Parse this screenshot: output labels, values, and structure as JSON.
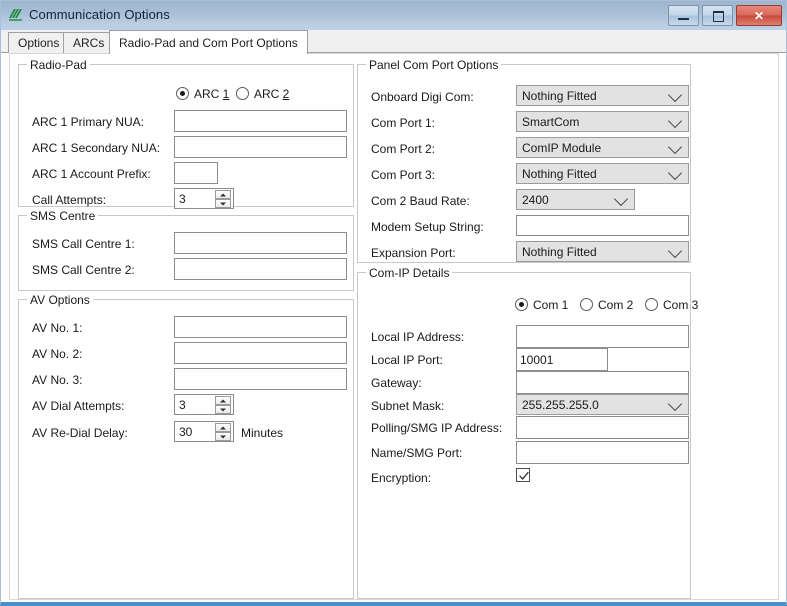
{
  "window": {
    "title": "Communication Options",
    "icon": "app-logo-icon",
    "buttons": {
      "minimize": "–",
      "maximize": "□",
      "close": "✕"
    }
  },
  "tabs": [
    {
      "label": "Options",
      "active": false
    },
    {
      "label": "ARCs",
      "active": false
    },
    {
      "label": "Radio-Pad and Com Port Options",
      "active": true
    }
  ],
  "radio_pad": {
    "legend": "Radio-Pad",
    "arc_radios": [
      {
        "label_prefix": "ARC ",
        "label_key": "1",
        "selected": true
      },
      {
        "label_prefix": "ARC ",
        "label_key": "2",
        "selected": false
      }
    ],
    "fields": [
      {
        "label": "ARC 1 Primary NUA:",
        "value": ""
      },
      {
        "label": "ARC 1 Secondary NUA:",
        "value": ""
      },
      {
        "label": "ARC 1 Account Prefix:",
        "value": ""
      }
    ],
    "call_attempts": {
      "label": "Call Attempts:",
      "value": "3"
    }
  },
  "sms_centre": {
    "legend": "SMS Centre",
    "fields": [
      {
        "label": "SMS Call Centre 1:",
        "value": ""
      },
      {
        "label": "SMS Call Centre 2:",
        "value": ""
      }
    ]
  },
  "av_options": {
    "legend": "AV Options",
    "fields": [
      {
        "label": "AV No. 1:",
        "value": ""
      },
      {
        "label": "AV No. 2:",
        "value": ""
      },
      {
        "label": "AV No. 3:",
        "value": ""
      }
    ],
    "dial_attempts": {
      "label": "AV Dial Attempts:",
      "value": "3"
    },
    "redial_delay": {
      "label": "AV Re-Dial Delay:",
      "value": "30",
      "units": "Minutes"
    }
  },
  "panel_com_port": {
    "legend": "Panel Com Port Options",
    "combos": [
      {
        "label": "Onboard Digi Com:",
        "value": "Nothing Fitted"
      },
      {
        "label": "Com Port 1:",
        "value": "SmartCom"
      },
      {
        "label": "Com Port 2:",
        "value": "ComIP Module"
      },
      {
        "label": "Com Port 3:",
        "value": "Nothing Fitted"
      }
    ],
    "baud_rate": {
      "label": "Com 2 Baud Rate:",
      "value": "2400"
    },
    "modem_setup": {
      "label": "Modem Setup String:",
      "value": ""
    },
    "expansion_port": {
      "label": "Expansion Port:",
      "value": "Nothing Fitted"
    }
  },
  "com_ip_details": {
    "legend": "Com-IP Details",
    "com_radios": [
      {
        "label": "Com 1",
        "selected": true
      },
      {
        "label": "Com 2",
        "selected": false
      },
      {
        "label": "Com 3",
        "selected": false
      }
    ],
    "local_ip_address": {
      "label": "Local IP Address:",
      "value": ""
    },
    "local_ip_port": {
      "label": "Local IP Port:",
      "value": "10001"
    },
    "gateway": {
      "label": "Gateway:",
      "value": ""
    },
    "subnet_mask": {
      "label": "Subnet Mask:",
      "value": "255.255.255.0"
    },
    "polling_ip": {
      "label": "Polling/SMG IP Address:",
      "value": ""
    },
    "name_smg_port": {
      "label": "Name/SMG Port:",
      "value": ""
    },
    "encryption": {
      "label": "Encryption:",
      "checked": true
    }
  },
  "colors": {
    "titlebar_top": "#9eb5cd",
    "titlebar_bottom": "#bdd1e6",
    "window_accent": "#4a90cc",
    "close_button": "#c74a3d",
    "combo_bg": "#e2e2e2"
  }
}
